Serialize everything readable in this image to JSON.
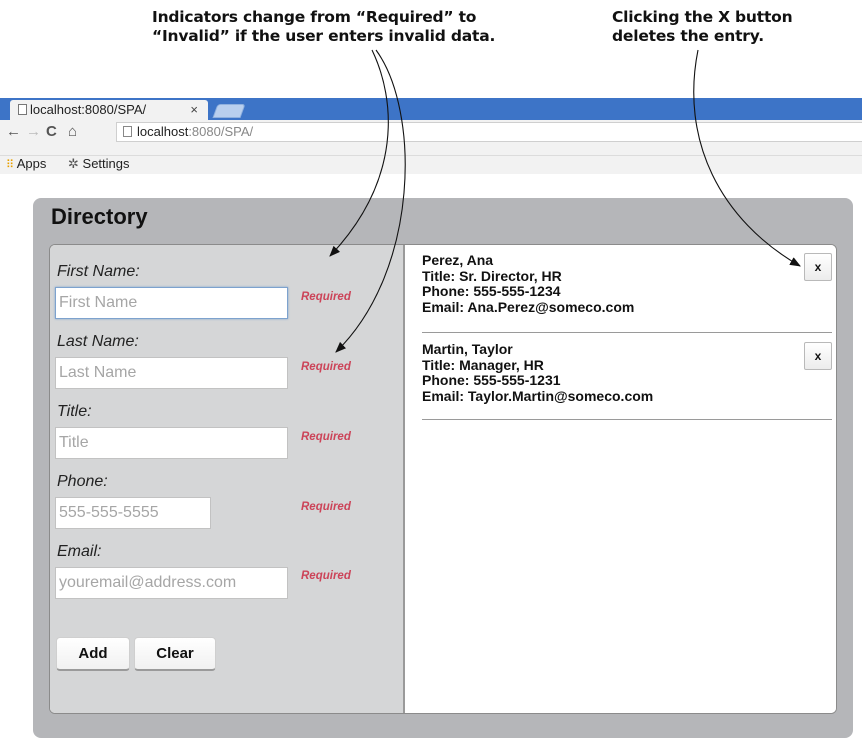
{
  "annotations": {
    "left": [
      "Indicators change from “Required” to",
      "“Invalid” if the user enters invalid data."
    ],
    "right": [
      "Clicking the X button",
      "deletes the entry."
    ]
  },
  "browser": {
    "tab_title": "localhost:8080/SPA/",
    "tab_close": "×",
    "url_host": "localhost",
    "url_rest": ":8080/SPA/",
    "bookmarks": {
      "apps": "Apps",
      "settings": "Settings"
    }
  },
  "app": {
    "title": "Directory",
    "form": {
      "first_name": {
        "label": "First Name:",
        "placeholder": "First Name",
        "status": "Required"
      },
      "last_name": {
        "label": "Last Name:",
        "placeholder": "Last Name",
        "status": "Required"
      },
      "title": {
        "label": "Title:",
        "placeholder": "Title",
        "status": "Required"
      },
      "phone": {
        "label": "Phone:",
        "placeholder": "555-555-5555",
        "status": "Required"
      },
      "email": {
        "label": "Email:",
        "placeholder": "youremail@address.com",
        "status": "Required"
      },
      "add_label": "Add",
      "clear_label": "Clear"
    },
    "entries": [
      {
        "name": "Perez, Ana",
        "title": "Title: Sr. Director, HR",
        "phone": "Phone: 555-555-1234",
        "email": "Email: Ana.Perez@someco.com",
        "delete_label": "x"
      },
      {
        "name": "Martin, Taylor",
        "title": "Title: Manager, HR",
        "phone": "Phone: 555-555-1231",
        "email": "Email: Taylor.Martin@someco.com",
        "delete_label": "x"
      }
    ]
  },
  "colors": {
    "required": "#cc4459",
    "tabstrip": "#3d74c7",
    "panel": "#b5b6b9",
    "form_bg": "#d5d6d7"
  },
  "icons": [
    "page-icon",
    "back-arrow-icon",
    "forward-arrow-icon",
    "reload-icon",
    "home-icon",
    "apps-grid-icon",
    "gear-icon"
  ]
}
